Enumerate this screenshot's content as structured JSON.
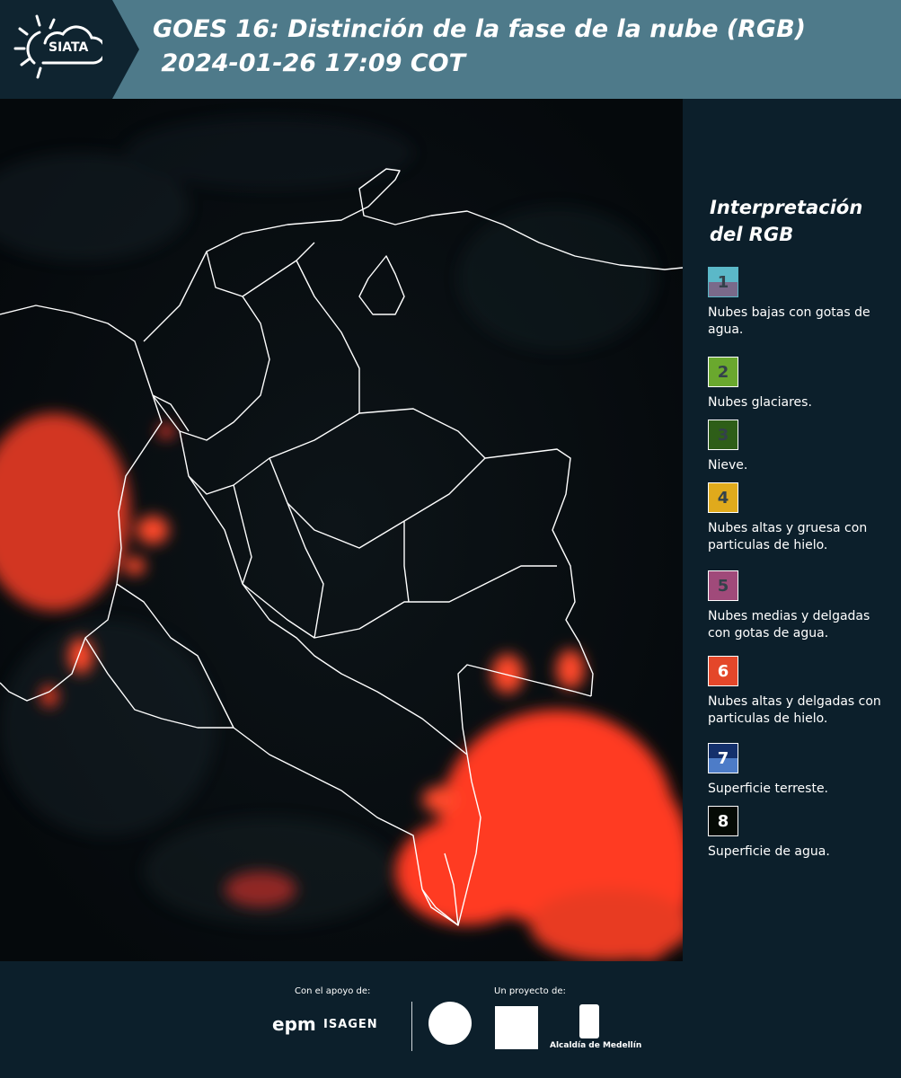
{
  "header": {
    "logo_text": "SIATA",
    "title_line1": "GOES 16: Distinción de la fase de la nube (RGB)",
    "title_line2": " 2024-01-26 17:09 COT",
    "background_color": "#4e7a8a"
  },
  "legend": {
    "title_line1": "Interpretación",
    "title_line2": "del RGB",
    "items": [
      {
        "number": "1",
        "label": "Nubes bajas con gotas de agua.",
        "color_top": "#5bb8c8",
        "color_bottom": "#7a6a8a"
      },
      {
        "number": "2",
        "label": "Nubes glaciares.",
        "color_top": "#6aa82e",
        "color_bottom": "#6aa82e"
      },
      {
        "number": "3",
        "label": "Nieve.",
        "color_top": "#2e5e18",
        "color_bottom": "#2e5e18"
      },
      {
        "number": "4",
        "label": "Nubes altas y gruesa con particulas de hielo.",
        "color_top": "#e0aa1c",
        "color_bottom": "#e0aa1c"
      },
      {
        "number": "5",
        "label": "Nubes medias y delgadas con gotas de agua.",
        "color_top": "#a04a7a",
        "color_bottom": "#a04a7a"
      },
      {
        "number": "6",
        "label": "Nubes altas y delgadas con particulas de hielo.",
        "color_top": "#e4472a",
        "color_bottom": "#e4472a"
      },
      {
        "number": "7",
        "label": "Superficie terreste.",
        "color_top": "#14306c",
        "color_bottom": "#4d7cc8"
      },
      {
        "number": "8",
        "label": "Superficie de agua.",
        "color_top": "#050a05",
        "color_bottom": "#050a05"
      }
    ]
  },
  "footer": {
    "support_label": "Con el apoyo de:",
    "project_label": "Un proyecto de:",
    "epm_text": "epm",
    "isagen_text": "ISAGEN",
    "alcaldia_text": "Alcaldía de Medellín"
  },
  "map": {
    "cloud_color": "#ff3a22",
    "background_color": "#05090c",
    "border_color": "#ffffff"
  }
}
